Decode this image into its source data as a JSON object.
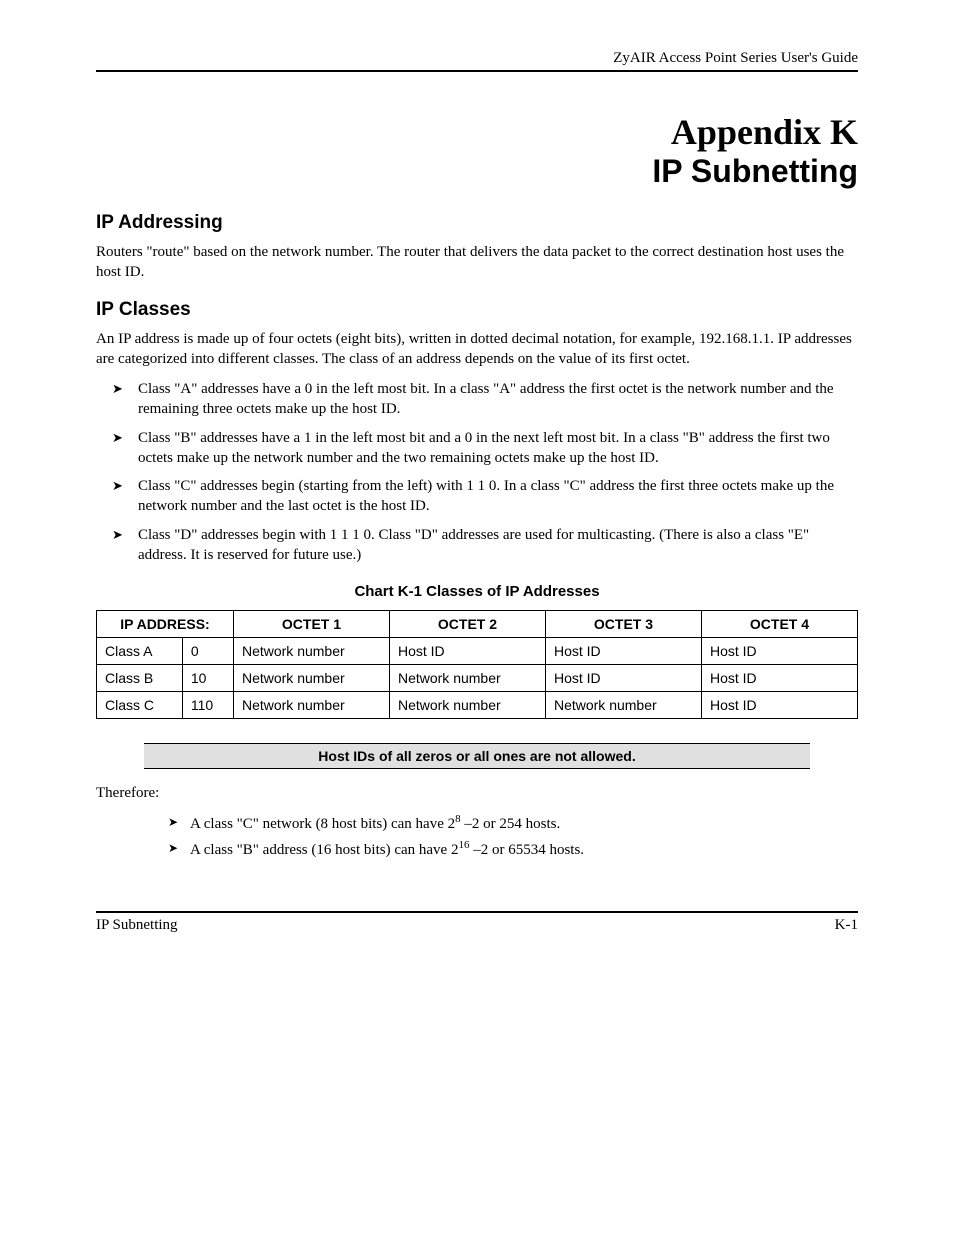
{
  "header": {
    "text": "ZyAIR Access Point Series User's Guide"
  },
  "title": {
    "line1": "Appendix K",
    "line2": "IP Subnetting"
  },
  "sections": {
    "ip_addressing": {
      "heading": "IP Addressing",
      "para": "Routers \"route\" based on the network number. The router that delivers the data packet to the correct destination host uses the host ID."
    },
    "ip_classes": {
      "heading": "IP Classes",
      "para": "An IP address is made up of four octets (eight bits), written in dotted decimal notation, for example, 192.168.1.1. IP addresses are categorized into different classes. The class of an address depends on the value of its first octet.",
      "bullets": [
        "Class \"A\" addresses have a 0 in the left most bit. In a class \"A\" address the first octet is the network number and the remaining three octets make up the host ID.",
        "Class \"B\" addresses have a 1 in the left most bit and a 0 in the next left most bit. In a class \"B\" address the first two octets make up the network number and the two remaining octets make up the host ID.",
        "Class \"C\" addresses begin (starting from the left) with 1 1 0. In a class \"C\" address the first three octets make up the network number and the last octet is the host ID.",
        "Class \"D\" addresses begin with 1 1 1 0. Class \"D\" addresses are used for multicasting. (There is also a class \"E\" address. It is reserved for future use.)"
      ]
    }
  },
  "chart_title": "Chart K-1 Classes of IP Addresses",
  "chart_data": {
    "type": "table",
    "title": "Chart K-1 Classes of IP Addresses",
    "headers": [
      "IP ADDRESS:",
      "OCTET 1",
      "OCTET 2",
      "OCTET 3",
      "OCTET 4"
    ],
    "rows": [
      {
        "class": "Class A",
        "prefix": "0",
        "o1": "Network number",
        "o2": "Host ID",
        "o3": "Host ID",
        "o4": "Host ID"
      },
      {
        "class": "Class B",
        "prefix": "10",
        "o1": "Network number",
        "o2": "Network number",
        "o3": "Host ID",
        "o4": "Host ID"
      },
      {
        "class": "Class C",
        "prefix": "110",
        "o1": "Network number",
        "o2": "Network number",
        "o3": "Network number",
        "o4": "Host ID"
      }
    ]
  },
  "note": "Host IDs of all zeros or all ones are not allowed.",
  "therefore": {
    "label": "Therefore:",
    "items": [
      {
        "pre": "A class \"C\" network (8 host bits) can have 2",
        "exp": "8",
        "post": " –2 or 254 hosts."
      },
      {
        "pre": "A class \"B\" address (16 host bits) can have 2",
        "exp": "16",
        "post": " –2 or 65534 hosts."
      }
    ]
  },
  "footer": {
    "left": "IP Subnetting",
    "right": "K-1"
  }
}
